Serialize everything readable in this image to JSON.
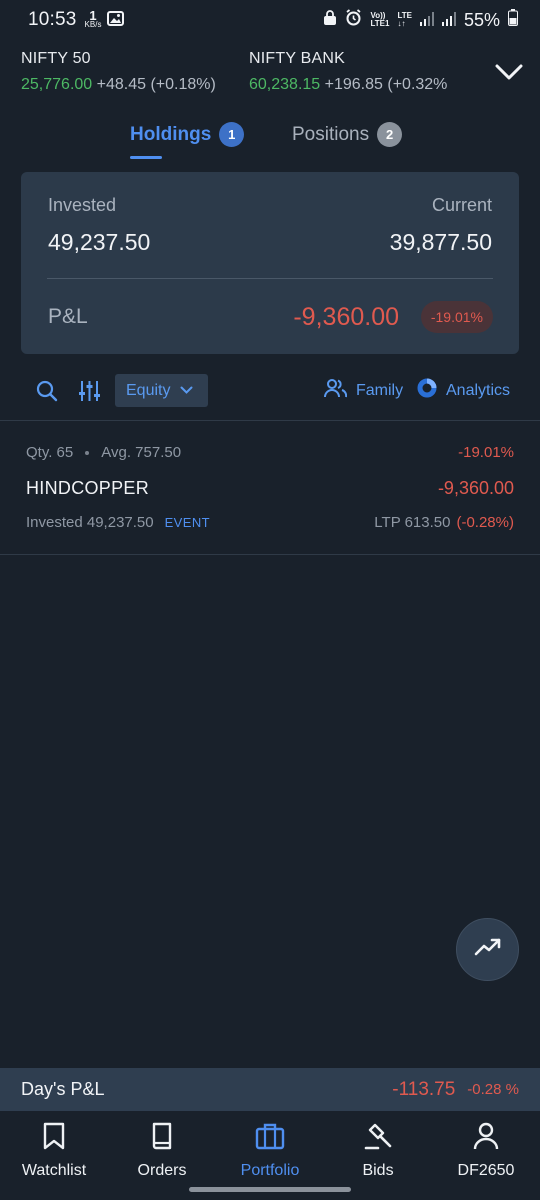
{
  "status_bar": {
    "time": "10:53",
    "speed_value": "1",
    "speed_unit": "KB/s",
    "network_label_top": "Vo))",
    "network_label_bottom": "LTE1",
    "lte_label": "LTE",
    "battery": "55%"
  },
  "indices": [
    {
      "name": "NIFTY 50",
      "value": "25,776.00",
      "change": "+48.45 (+0.18%)"
    },
    {
      "name": "NIFTY BANK",
      "value": "60,238.15",
      "change": "+196.85 (+0.32%"
    }
  ],
  "tabs": [
    {
      "label": "Holdings",
      "count": "1",
      "active": true
    },
    {
      "label": "Positions",
      "count": "2",
      "active": false
    }
  ],
  "summary": {
    "invested_label": "Invested",
    "invested_value": "49,237.50",
    "current_label": "Current",
    "current_value": "39,877.50",
    "pnl_label": "P&L",
    "pnl_value": "-9,360.00",
    "pnl_percent": "-19.01%"
  },
  "toolbar": {
    "filter_value": "Equity",
    "family_label": "Family",
    "analytics_label": "Analytics"
  },
  "holdings": [
    {
      "qty": "Qty. 65",
      "avg": "Avg. 757.50",
      "pnl_percent": "-19.01%",
      "symbol": "HINDCOPPER",
      "pnl": "-9,360.00",
      "invested": "Invested 49,237.50",
      "tag": "EVENT",
      "ltp": "LTP 613.50",
      "ltp_change": "(-0.28%)"
    }
  ],
  "day_pnl": {
    "label": "Day's P&L",
    "value": "-113.75",
    "percent": "-0.28 %"
  },
  "bottom_nav": [
    {
      "label": "Watchlist",
      "icon": "bookmark-icon",
      "active": false
    },
    {
      "label": "Orders",
      "icon": "book-icon",
      "active": false
    },
    {
      "label": "Portfolio",
      "icon": "briefcase-icon",
      "active": true
    },
    {
      "label": "Bids",
      "icon": "gavel-icon",
      "active": false
    },
    {
      "label": "DF2650",
      "icon": "user-icon",
      "active": false
    }
  ],
  "colors": {
    "background": "#19212b",
    "card": "#2c3a4a",
    "accent": "#4f8ff0",
    "positive": "#4db864",
    "negative": "#e05a4f"
  }
}
